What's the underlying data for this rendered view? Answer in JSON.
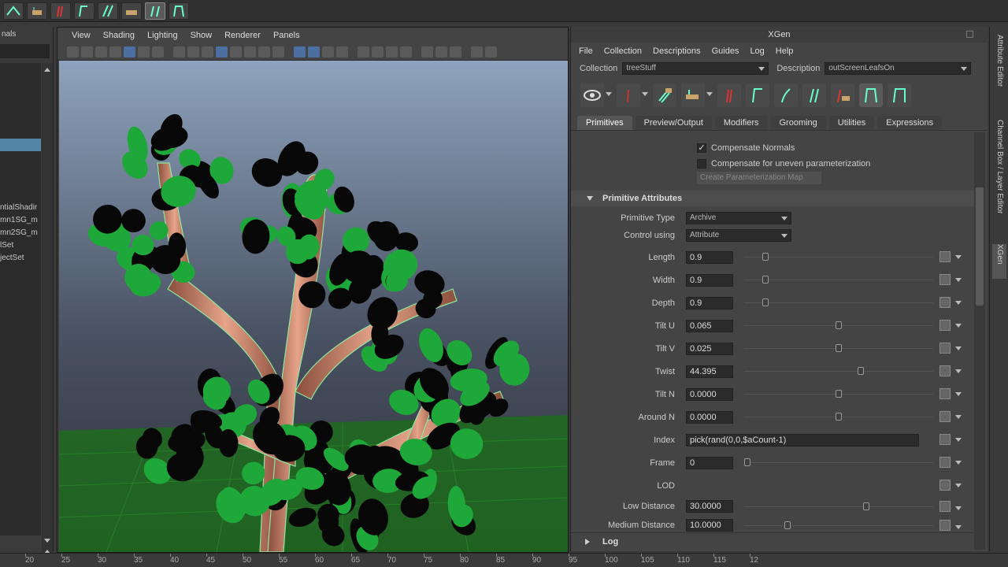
{
  "shelf": {
    "icons": [
      "xgen-tool-icon",
      "xgen-tool-icon",
      "xgen-guide-icon",
      "xgen-guide-icon",
      "xgen-tool-icon",
      "xgen-tool-icon",
      "xgen-guide-icon",
      "xgen-guide-icon"
    ]
  },
  "outliner": {
    "header": "nals",
    "items": [
      "",
      "",
      "",
      "",
      "",
      "",
      "",
      "",
      "",
      "",
      "",
      "ntialShadir",
      "mn1SG_m",
      "mn2SG_m",
      "lSet",
      "jectSet"
    ],
    "selected_index": 6
  },
  "viewport": {
    "menus": [
      "View",
      "Shading",
      "Lighting",
      "Show",
      "Renderer",
      "Panels"
    ]
  },
  "xgen": {
    "title": "XGen",
    "menus": [
      "File",
      "Collection",
      "Descriptions",
      "Guides",
      "Log",
      "Help"
    ],
    "collection_label": "Collection",
    "collection_value": "treeStuff",
    "description_label": "Description",
    "description_value": "outScreenLeafsOn",
    "tabs": [
      "Primitives",
      "Preview/Output",
      "Modifiers",
      "Grooming",
      "Utilities",
      "Expressions"
    ],
    "active_tab": "Primitives",
    "checks": [
      {
        "label": "Compensate Normals",
        "checked": true
      },
      {
        "label": "Compensate for uneven parameterization",
        "checked": false
      }
    ],
    "create_button": "Create Parameterization Map",
    "section": "Primitive Attributes",
    "primitive_type_label": "Primitive Type",
    "primitive_type_value": "Archive",
    "control_using_label": "Control using",
    "control_using_value": "Attribute",
    "attributes": [
      {
        "label": "Length",
        "value": "0.9",
        "slider": 0.1
      },
      {
        "label": "Width",
        "value": "0.9",
        "slider": 0.1
      },
      {
        "label": "Depth",
        "value": "0.9",
        "slider": 0.1
      },
      {
        "label": "Tilt U",
        "value": "0.065",
        "slider": 0.5
      },
      {
        "label": "Tilt V",
        "value": "0.025",
        "slider": 0.5
      },
      {
        "label": "Twist",
        "value": "44.395",
        "slider": 0.62
      },
      {
        "label": "Tilt N",
        "value": "0.0000",
        "slider": 0.5
      },
      {
        "label": "Around N",
        "value": "0.0000",
        "slider": 0.5
      },
      {
        "label": "Index",
        "value": "pick(rand(0,0,$aCount-1)"
      },
      {
        "label": "Frame",
        "value": "0",
        "slider": 0.0
      },
      {
        "label": "LOD",
        "value": ""
      },
      {
        "label": "Low Distance",
        "value": "30.0000",
        "slider": 0.65
      },
      {
        "label": "Medium Distance",
        "value": "10.0000",
        "slider": 0.22
      }
    ],
    "log_label": "Log"
  },
  "side_tabs": [
    "Attribute Editor",
    "Channel Box / Layer Editor",
    "XGen"
  ],
  "ruler": {
    "ticks": [
      "20",
      "25",
      "30",
      "35",
      "40",
      "45",
      "50",
      "55",
      "60",
      "65",
      "70",
      "75",
      "80",
      "85",
      "90",
      "95",
      "100",
      "105",
      "110",
      "115",
      "12"
    ]
  },
  "colors": {
    "selection": "#5285a6",
    "leaf_green": "#1fa83a",
    "branch": "#c98a6e",
    "wireframe": "#7dff9a",
    "grid": "#1f6a1f"
  }
}
